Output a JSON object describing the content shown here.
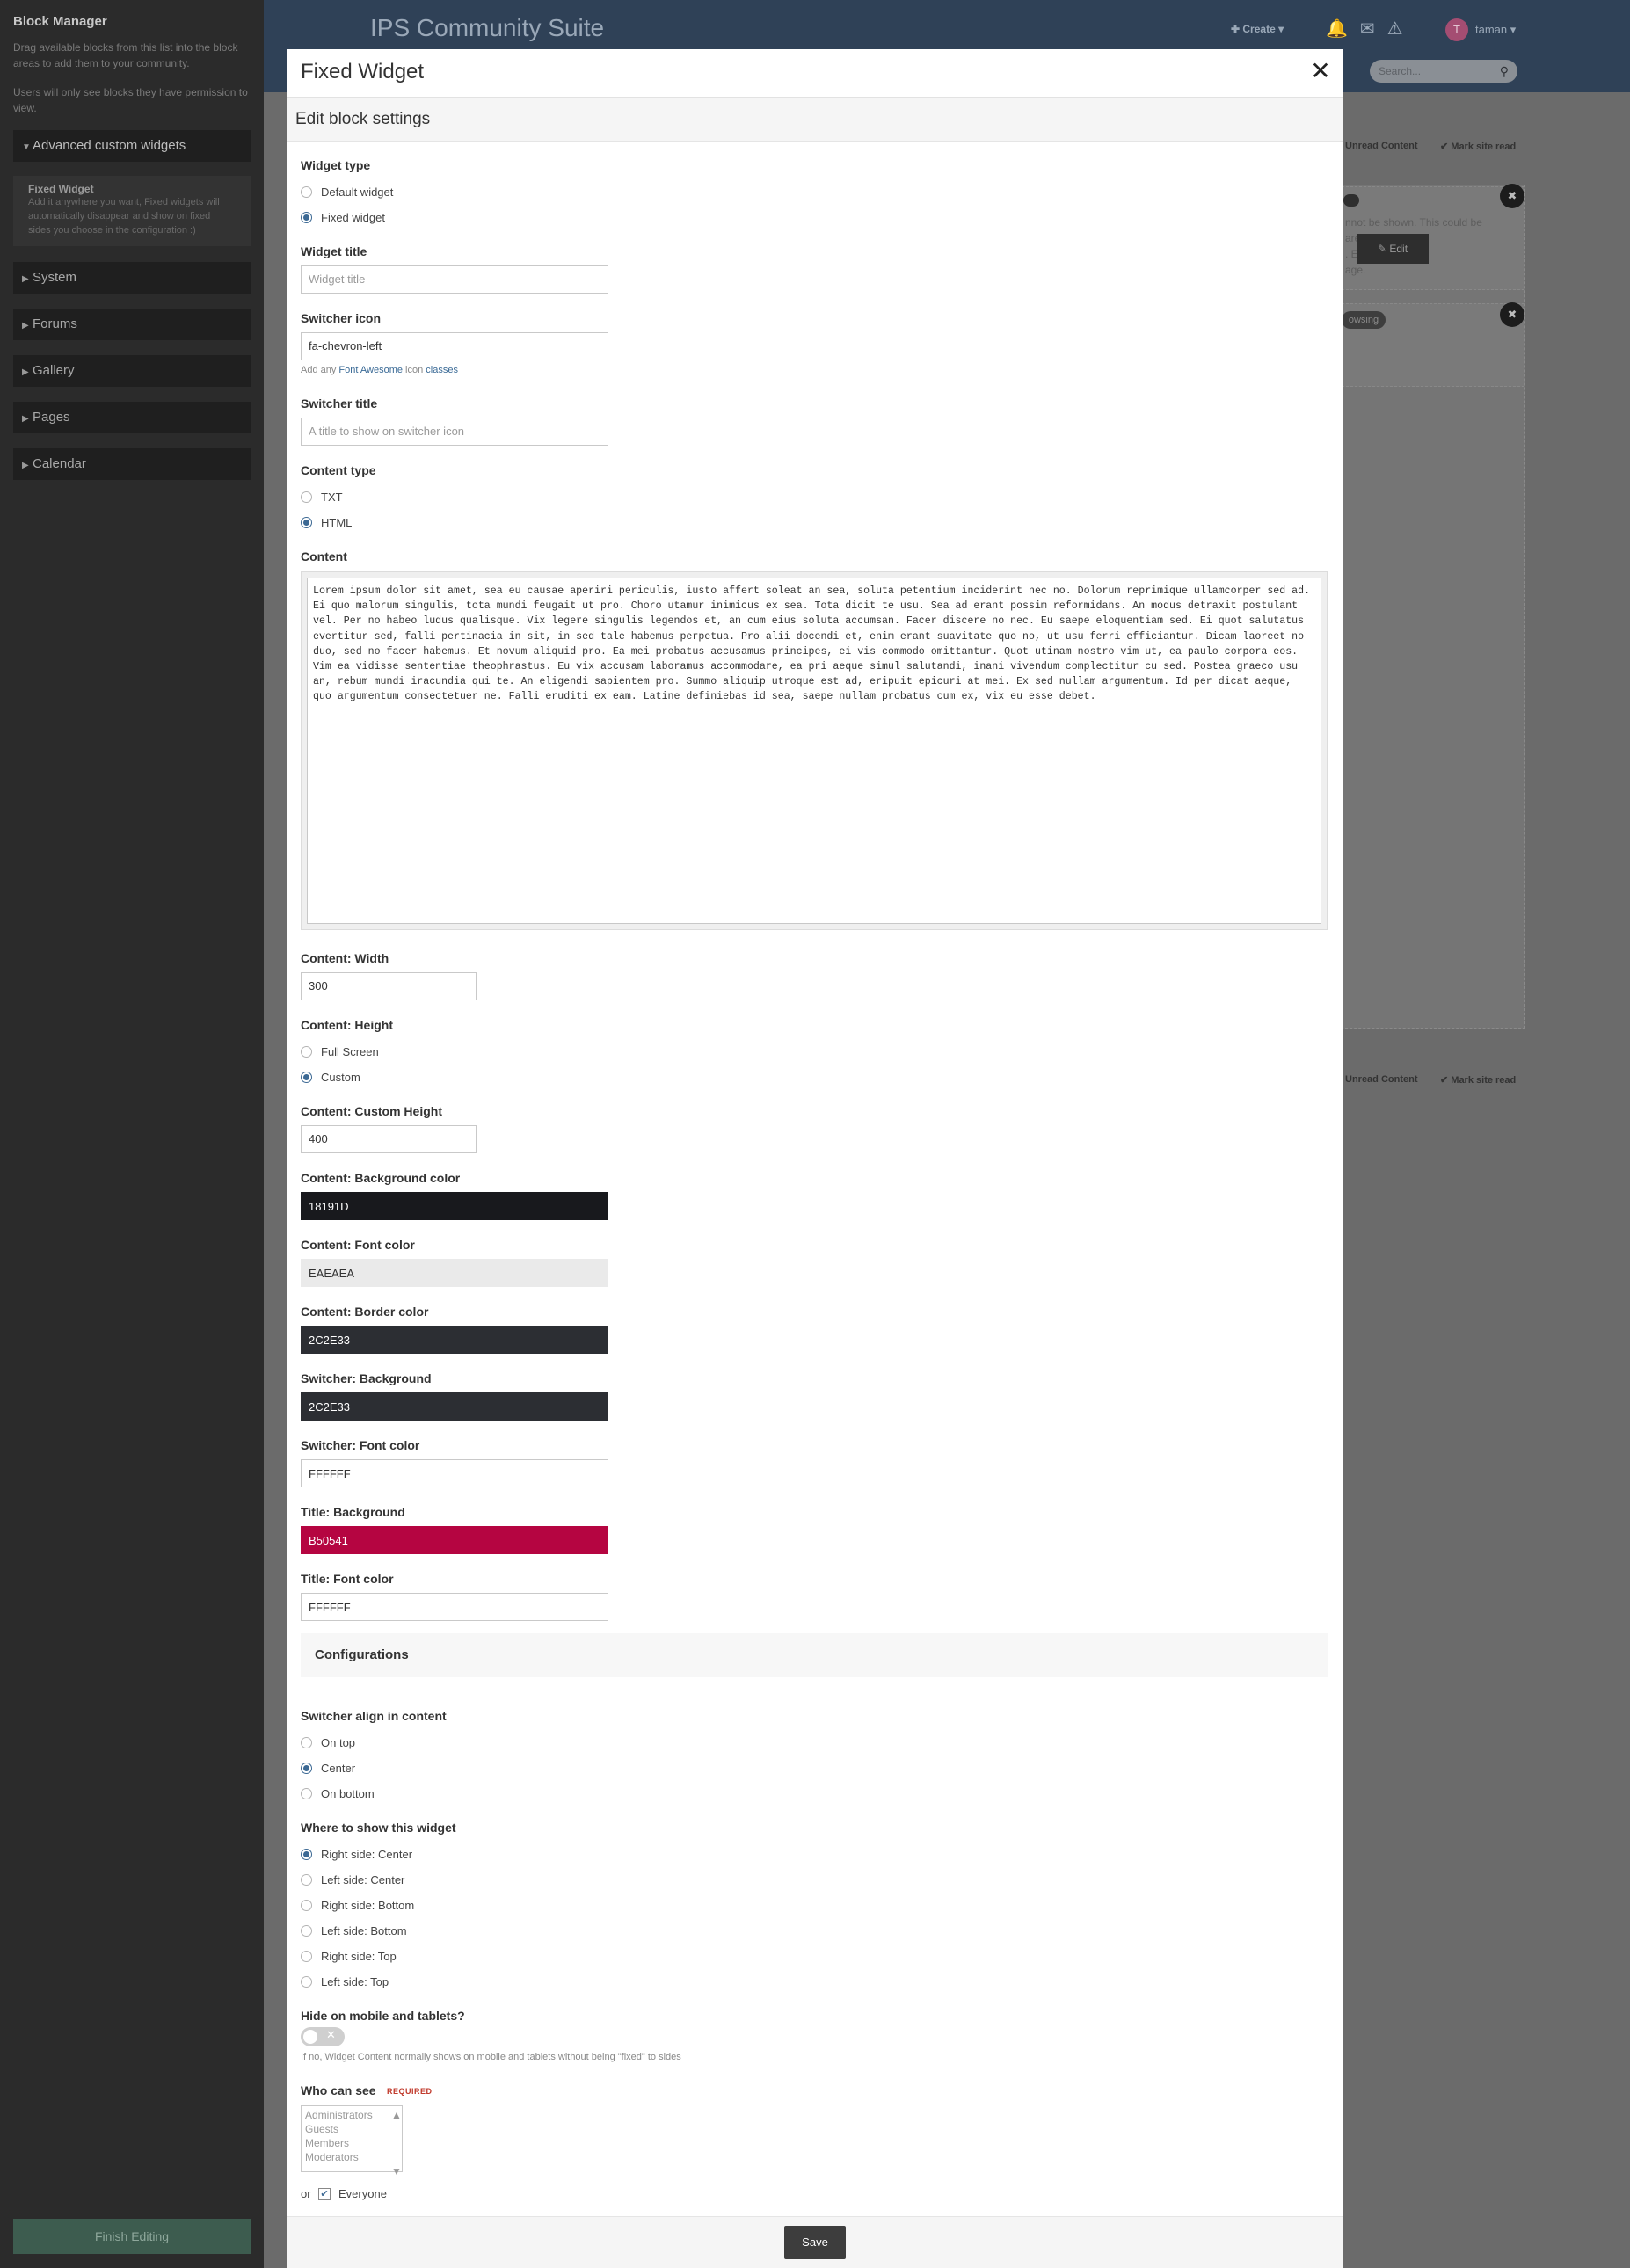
{
  "sidebar": {
    "title": "Block Manager",
    "desc1": "Drag available blocks from this list into the block areas to add them to your community.",
    "desc2": "Users will only see blocks they have permission to view.",
    "categories": [
      {
        "label": "Advanced custom widgets",
        "open": true
      },
      {
        "label": "System"
      },
      {
        "label": "Forums"
      },
      {
        "label": "Gallery"
      },
      {
        "label": "Pages"
      },
      {
        "label": "Calendar"
      }
    ],
    "block": {
      "title": "Fixed Widget",
      "desc": "Add it anywhere you want, Fixed widgets will automatically disappear and show on fixed sides you choose in the configuration :)"
    },
    "finish_label": "Finish Editing"
  },
  "background": {
    "site_title": "IPS Community Suite",
    "create_label": "Create",
    "user_initial": "T",
    "user_name": "taman",
    "search_placeholder": "Search...",
    "link_control": "Unread Content",
    "link_read": "Mark site read",
    "edit_label": "Edit",
    "pill_label": "owsing",
    "snippet": "nnot be shown. This could be\nare unable to\n. Either\nage."
  },
  "modal": {
    "title": "Fixed Widget",
    "section_title": "Edit block settings",
    "widget_type": {
      "label": "Widget type",
      "options": [
        "Default widget",
        "Fixed widget"
      ],
      "selected": 1
    },
    "widget_title": {
      "label": "Widget title",
      "placeholder": "Widget title",
      "value": ""
    },
    "switcher_icon": {
      "label": "Switcher icon",
      "value": "fa-chevron-left",
      "hint_pre": "Add any ",
      "hint_link": "Font Awesome",
      "hint_mid": " icon ",
      "hint_post": "classes"
    },
    "switcher_title": {
      "label": "Switcher title",
      "placeholder": "A title to show on switcher icon",
      "value": ""
    },
    "content_type": {
      "label": "Content type",
      "options": [
        "TXT",
        "HTML"
      ],
      "selected": 1
    },
    "content": {
      "label": "Content",
      "value": "Lorem ipsum dolor sit amet, sea eu causae aperiri periculis, iusto affert soleat an sea, soluta petentium inciderint nec no. Dolorum reprimique ullamcorper sed ad. Ei quo malorum singulis, tota mundi feugait ut pro. Choro utamur inimicus ex sea. Tota dicit te usu. Sea ad erant possim reformidans. An modus detraxit postulant vel. Per no habeo ludus qualisque. Vix legere singulis legendos et, an cum eius soluta accumsan. Facer discere no nec. Eu saepe eloquentiam sed. Ei quot salutatus evertitur sed, falli pertinacia in sit, in sed tale habemus perpetua. Pro alii docendi et, enim erant suavitate quo no, ut usu ferri efficiantur. Dicam laoreet no duo, sed no facer habemus. Et novum aliquid pro. Ea mei probatus accusamus principes, ei vis commodo omittantur. Quot utinam nostro vim ut, ea paulo corpora eos. Vim ea vidisse sententiae theophrastus. Eu vix accusam laboramus accommodare, ea pri aeque simul salutandi, inani vivendum complectitur cu sed. Postea graeco usu an, rebum mundi iracundia qui te. An eligendi sapientem pro. Summo aliquip utroque est ad, eripuit epicuri at mei. Ex sed nullam argumentum. Id per dicat aeque, quo argumentum consectetuer ne. Falli eruditi ex eam. Latine definiebas id sea, saepe nullam probatus cum ex, vix eu esse debet."
    },
    "content_width": {
      "label": "Content: Width",
      "value": "300"
    },
    "content_height": {
      "label": "Content: Height",
      "options": [
        "Full Screen",
        "Custom"
      ],
      "selected": 1
    },
    "content_custom_height": {
      "label": "Content: Custom Height",
      "value": "400"
    },
    "colors": [
      {
        "label": "Content: Background color",
        "value": "18191D",
        "bg": "#18191d",
        "fg": "#ffffff"
      },
      {
        "label": "Content: Font color",
        "value": "EAEAEA",
        "bg": "#eaeaea",
        "fg": "#333333"
      },
      {
        "label": "Content: Border color",
        "value": "2C2E33",
        "bg": "#2c2e33",
        "fg": "#ffffff"
      },
      {
        "label": "Switcher: Background",
        "value": "2C2E33",
        "bg": "#2c2e33",
        "fg": "#ffffff"
      },
      {
        "label": "Switcher: Font color",
        "value": "FFFFFF",
        "bg": "#ffffff",
        "fg": "#333333"
      },
      {
        "label": "Title: Background",
        "value": "B50541",
        "bg": "#b50541",
        "fg": "#ffffff"
      },
      {
        "label": "Title: Font color",
        "value": "FFFFFF",
        "bg": "#ffffff",
        "fg": "#333333"
      }
    ],
    "configurations_title": "Configurations",
    "switcher_align": {
      "label": "Switcher align in content",
      "options": [
        "On top",
        "Center",
        "On bottom"
      ],
      "selected": 1
    },
    "where_show": {
      "label": "Where to show this widget",
      "options": [
        "Right side: Center",
        "Left side: Center",
        "Right side: Bottom",
        "Left side: Bottom",
        "Right side: Top",
        "Left side: Top"
      ],
      "selected": 0
    },
    "hide_mobile": {
      "label": "Hide on mobile and tablets?",
      "value": false,
      "hint": "If no, Widget Content normally shows on mobile and tablets without being \"fixed\" to sides"
    },
    "who_can_see": {
      "label": "Who can see",
      "required_label": "REQUIRED",
      "options": [
        "Administrators",
        "Guests",
        "Members",
        "Moderators"
      ],
      "or_label": "or",
      "everyone_label": "Everyone",
      "everyone_checked": true
    },
    "save_label": "Save",
    "close_glyph": "✕"
  }
}
